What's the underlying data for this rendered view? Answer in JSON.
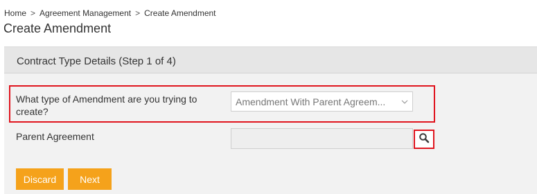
{
  "breadcrumb": {
    "items": [
      "Home",
      "Agreement Management",
      "Create Amendment"
    ],
    "separator": ">"
  },
  "page": {
    "title": "Create Amendment"
  },
  "panel": {
    "header": "Contract Type Details (Step 1 of 4)"
  },
  "form": {
    "amendment_type": {
      "label": "What type of Amendment are you trying to create?",
      "selected_value": "Amendment With Parent Agreem..."
    },
    "parent_agreement": {
      "label": "Parent Agreement",
      "value": ""
    }
  },
  "actions": {
    "discard_label": "Discard",
    "next_label": "Next"
  },
  "icons": {
    "search": "search-icon",
    "dropdown": "chevron-down-icon"
  },
  "colors": {
    "accent_button": "#f5a21b",
    "highlight_border": "#e0141e",
    "panel_background": "#f2f2f2",
    "panel_header_background": "#e6e6e6"
  }
}
